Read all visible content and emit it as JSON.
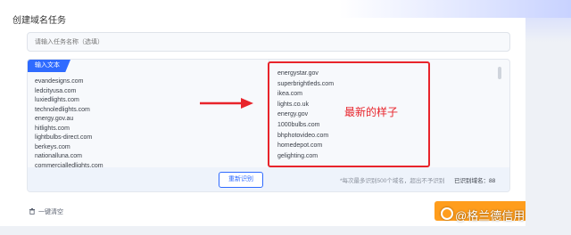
{
  "title": "创建域名任务",
  "task_name": {
    "placeholder": "请输入任务名称（选填）"
  },
  "input_tab": "输入文本",
  "left_domains": [
    "evandesigns.com",
    "ledcityusa.com",
    "luxiedlights.com",
    "technoledlights.com",
    "energy.gov.au",
    "hitlights.com",
    "lightbulbs-direct.com",
    "berkeys.com",
    "nationalluna.com",
    "commercialledlights.com"
  ],
  "right_domains": [
    "energystar.gov",
    "superbrightleds.com",
    "ikea.com",
    "lights.co.uk",
    "energy.gov",
    "1000bulbs.com",
    "bhphotovideo.com",
    "homedepot.com",
    "gelighting.com"
  ],
  "annotation": "最新的样子",
  "recognize_button": "重新识别",
  "hint": "*每次最多识别500个域名，超出不予识别",
  "recognized_count": "已识别域名：88",
  "clear_label": "一键清空",
  "watermark": "@格兰德信用",
  "colors": {
    "accent": "#2f6bff",
    "highlight": "#e8242b",
    "submit": "#ff9d1c"
  }
}
